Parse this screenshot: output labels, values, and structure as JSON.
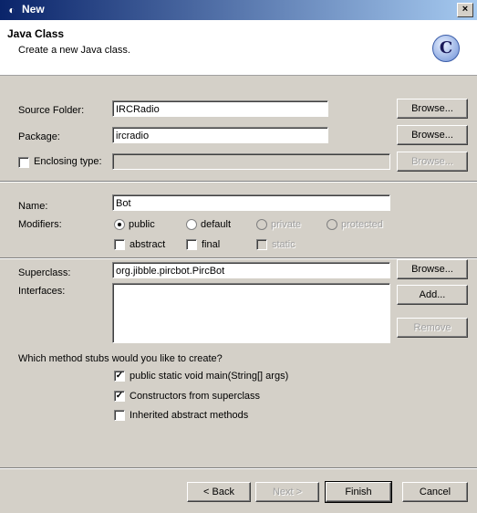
{
  "window": {
    "title": "New",
    "close_glyph": "×"
  },
  "banner": {
    "title": "Java Class",
    "description": "Create a new Java class.",
    "logo_letter": "C"
  },
  "source_folder": {
    "label": "Source Folder:",
    "value": "IRCRadio",
    "browse": "Browse..."
  },
  "package": {
    "label": "Package:",
    "value": "ircradio",
    "browse": "Browse..."
  },
  "enclosing": {
    "label": "Enclosing type:",
    "value": "",
    "browse": "Browse...",
    "checked": false
  },
  "name": {
    "label": "Name:",
    "value": "Bot"
  },
  "modifiers": {
    "label": "Modifiers:",
    "public": "public",
    "default": "default",
    "private": "private",
    "protected": "protected",
    "abstract": "abstract",
    "final": "final",
    "static": "static",
    "selected": "public"
  },
  "superclass": {
    "label": "Superclass:",
    "value": "org.jibble.pircbot.PircBot",
    "browse": "Browse..."
  },
  "interfaces": {
    "label": "Interfaces:",
    "add": "Add...",
    "remove": "Remove"
  },
  "stubs": {
    "question": "Which method stubs would you like to create?",
    "main": {
      "label": "public static void main(String[] args)",
      "checked": true
    },
    "constructors": {
      "label": "Constructors from superclass",
      "checked": true
    },
    "inherited": {
      "label": "Inherited abstract methods",
      "checked": false
    }
  },
  "footer": {
    "back": "< Back",
    "next": "Next >",
    "finish": "Finish",
    "cancel": "Cancel"
  },
  "check_glyph": "✓"
}
